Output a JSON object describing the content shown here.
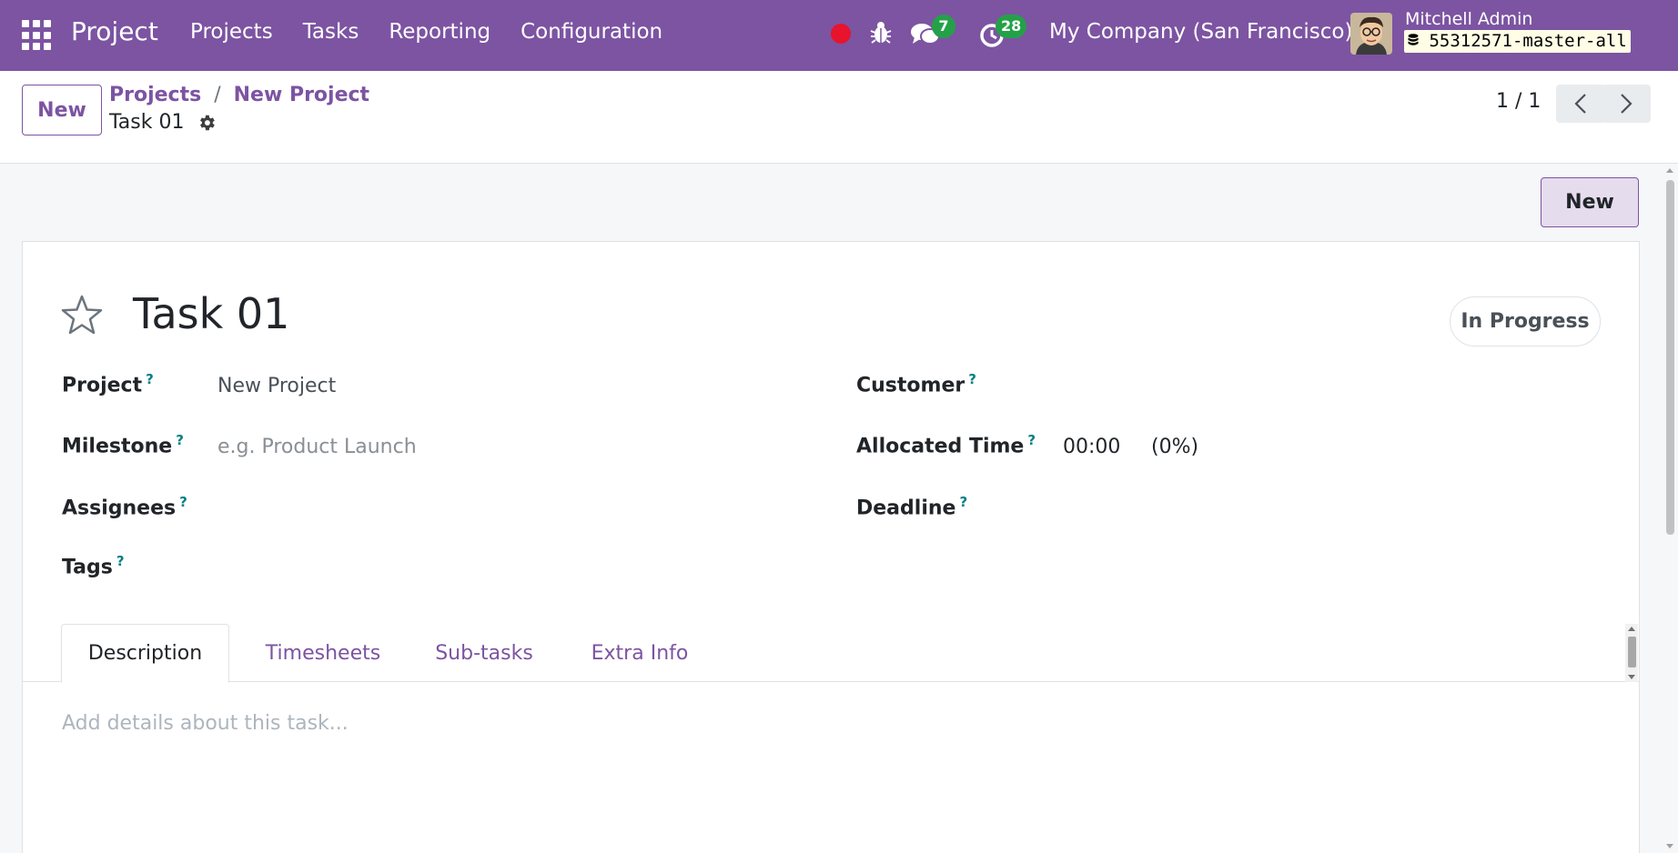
{
  "navbar": {
    "app_name": "Project",
    "menu": [
      "Projects",
      "Tasks",
      "Reporting",
      "Configuration"
    ],
    "messages_count": "7",
    "activities_count": "28",
    "company": "My Company (San Francisco)",
    "user_name": "Mitchell Admin",
    "database": "55312571-master-all",
    "colors": {
      "navbar_bg": "#7c54a2",
      "badge": "#24a148",
      "recording": "#e8132d"
    }
  },
  "control_panel": {
    "new_label": "New",
    "breadcrumb": [
      "Projects",
      "New Project"
    ],
    "breadcrumb_sep": "/",
    "record_name": "Task 01",
    "pager": "1 / 1"
  },
  "content": {
    "new_label": "New",
    "task_title": "Task 01",
    "stage": "In Progress",
    "fields_left": [
      {
        "label": "Project",
        "help": "?",
        "value": "New Project",
        "placeholder": ""
      },
      {
        "label": "Milestone",
        "help": "?",
        "value": "",
        "placeholder": "e.g. Product Launch"
      },
      {
        "label": "Assignees",
        "help": "?",
        "value": "",
        "placeholder": ""
      },
      {
        "label": "Tags",
        "help": "?",
        "value": "",
        "placeholder": ""
      }
    ],
    "fields_right": [
      {
        "label": "Customer",
        "help": "?",
        "value": ""
      },
      {
        "label": "Allocated Time",
        "help": "?",
        "value": "00:00",
        "extra": "(0%)"
      },
      {
        "label": "Deadline",
        "help": "?",
        "value": ""
      }
    ],
    "tabs": [
      "Description",
      "Timesheets",
      "Sub-tasks",
      "Extra Info"
    ],
    "active_tab": "Description",
    "description_placeholder": "Add details about this task..."
  }
}
